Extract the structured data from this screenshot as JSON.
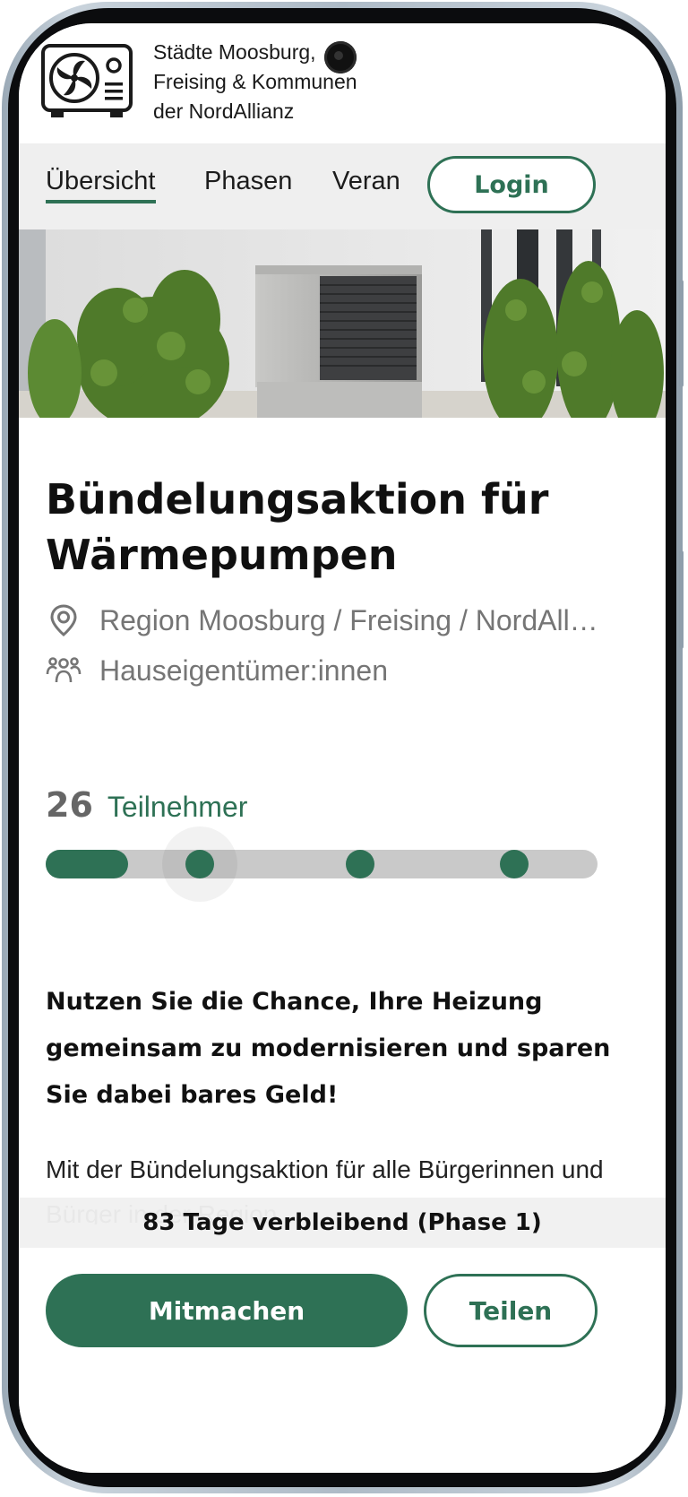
{
  "header": {
    "org_name": "Städte Moosburg,\nFreising & Kommunen\nder NordAllianz"
  },
  "nav": {
    "tabs": [
      {
        "label": "Übersicht",
        "active": true
      },
      {
        "label": "Phasen",
        "active": false
      },
      {
        "label": "Veran",
        "active": false
      }
    ],
    "login_label": "Login"
  },
  "hero": {
    "image": "house-with-heat-pump-photo"
  },
  "campaign": {
    "title": "Bündelungsaktion für Wärmepumpen",
    "location": "Region Moosburg / Freising / NordAllianz",
    "audience": "Hauseigentümer:innen",
    "participants_count": "26",
    "participants_label": "Teilnehmer",
    "progress_fraction": 0.15,
    "milestones_fraction": [
      0.279,
      0.57,
      0.849
    ],
    "lead_text": "Nutzen Sie die Chance, Ihre Heizung gemeinsam zu modernisieren und sparen Sie dabei bares Geld!",
    "body_text": "Mit der Bündelungsaktion für alle Bürgerinnen und Bürger in der Region"
  },
  "footer": {
    "remaining_text": "83 Tage verbleibend (Phase 1)",
    "join_label": "Mitmachen",
    "share_label": "Teilen"
  },
  "colors": {
    "accent": "#2e7155",
    "muted_text": "#757575",
    "track": "#c9c9c9"
  },
  "icons": {
    "logo": "heat-pump-logo-icon",
    "location": "map-pin-icon",
    "audience": "people-group-icon"
  }
}
